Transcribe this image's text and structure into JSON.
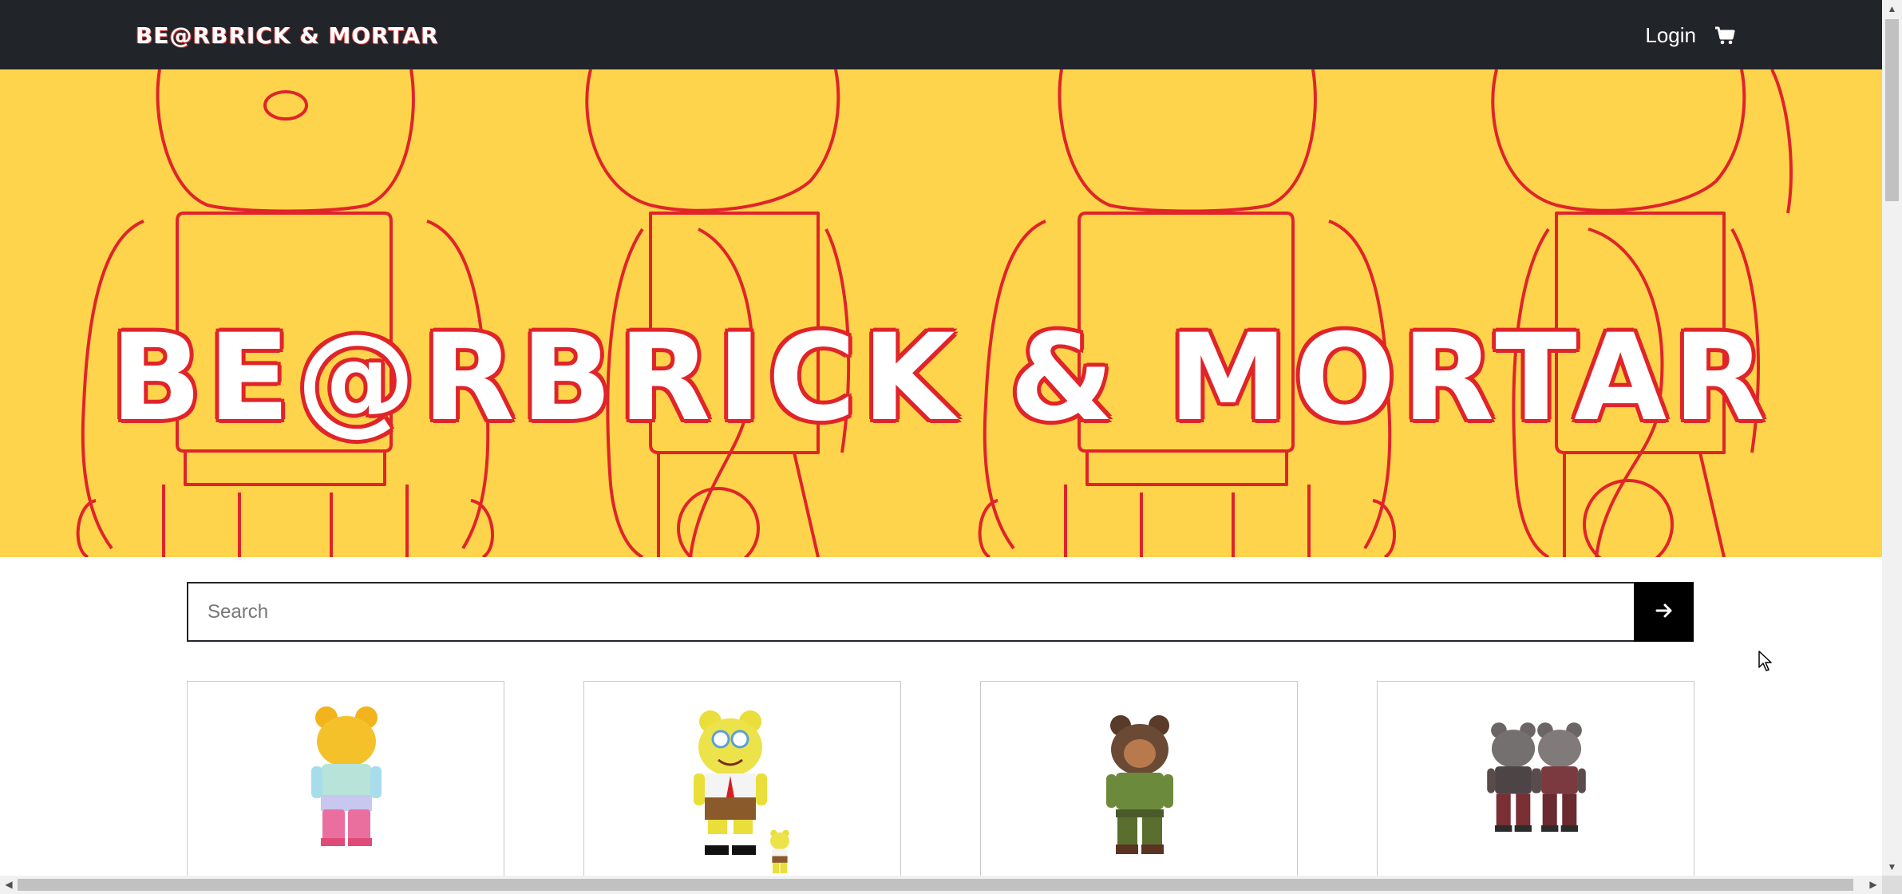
{
  "navbar": {
    "brand": "BE@RBRICK & MORTAR",
    "login_label": "Login",
    "cart_icon": "cart-icon"
  },
  "hero": {
    "title": "BE@RBRICK & MORTAR"
  },
  "search": {
    "placeholder": "Search",
    "value": "",
    "submit_icon": "arrow-right-icon"
  },
  "products": [
    {
      "name": "",
      "colors": {
        "head": "#f2b31c",
        "body": "#8fd3e8",
        "legs": "#ea6f9f"
      }
    },
    {
      "name": "",
      "colors": {
        "head": "#e9de3a",
        "body": "#f4f4f4",
        "legs": "#8a5a2b"
      }
    },
    {
      "name": "",
      "colors": {
        "head": "#6b4a35",
        "body": "#6c8a3b",
        "legs": "#5a6e2e"
      }
    },
    {
      "name": "",
      "colors": {
        "head": "#6b6565",
        "body": "#5a4c4c",
        "legs": "#7a2f35"
      }
    }
  ],
  "colors": {
    "navbar_bg": "#212529",
    "hero_bg": "#fdd44c",
    "hero_outline": "#e0242a"
  }
}
